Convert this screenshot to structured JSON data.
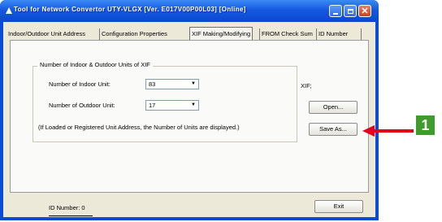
{
  "window": {
    "title": "Tool for Network Convertor UTY-VLGX [Ver. E017V00P00L03] [Online]",
    "close_glyph": "✕"
  },
  "tabs": [
    {
      "label": "Indoor/Outdoor Unit Address",
      "active": false
    },
    {
      "label": "Configuration Properties",
      "active": false
    },
    {
      "label": "XIF Making/Modifying",
      "active": true
    },
    {
      "label": "FROM Check Sum",
      "active": false
    },
    {
      "label": "ID Number",
      "active": false
    }
  ],
  "group": {
    "title": "Number of Indoor & Outdoor Units of XIF",
    "indoor_label": "Number of Indoor Unit:",
    "indoor_value": "83",
    "outdoor_label": "Number of Outdoor Unit:",
    "outdoor_value": "17",
    "note": "(If Loaded or Registered Unit Address, the Number of Units are displayed.)"
  },
  "xif_label": "XIF;",
  "buttons": {
    "open": "Open...",
    "save_as": "Save As...",
    "exit": "Exit"
  },
  "status": {
    "id_number": "ID Number:  0"
  },
  "callout": {
    "number": "1",
    "color": "#3f9b2c",
    "arrow_color": "#e2001a"
  },
  "icons": {
    "app": "app-icon",
    "dropdown": "chevron-down-icon"
  }
}
